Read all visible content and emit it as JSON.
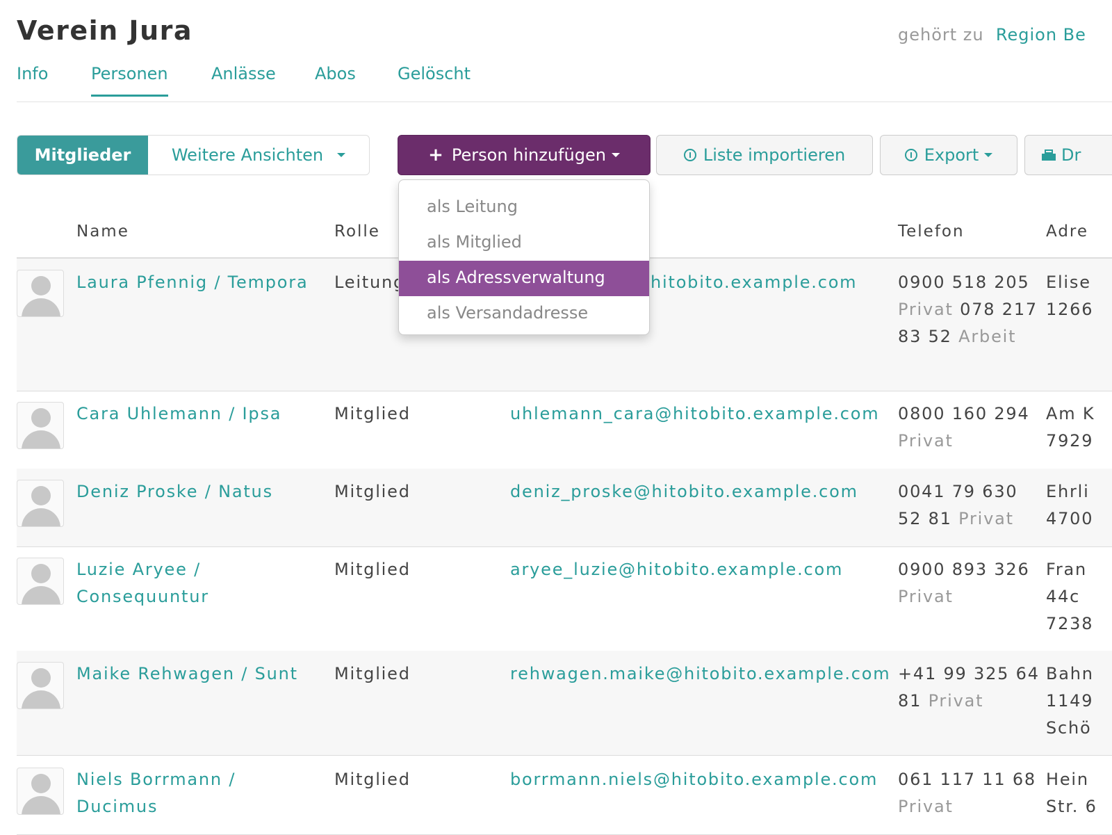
{
  "header": {
    "title": "Verein Jura",
    "belongs_to_label": "gehört zu",
    "belongs_to_link": "Region Be"
  },
  "tabs": [
    {
      "label": "Info"
    },
    {
      "label": "Personen"
    },
    {
      "label": "Anlässe"
    },
    {
      "label": "Abos"
    },
    {
      "label": "Gelöscht"
    }
  ],
  "toolbar": {
    "view_active": "Mitglieder",
    "view_more": "Weitere Ansichten",
    "add_person": "Person hinzufügen",
    "import_list": "Liste importieren",
    "export": "Export",
    "print": "Dr"
  },
  "add_person_menu": {
    "items": [
      "als Leitung",
      "als Mitglied",
      "als Adressverwaltung",
      "als Versandadresse"
    ],
    "highlighted": "als Adressverwaltung"
  },
  "table": {
    "columns": [
      "Name",
      "Rolle",
      "Telefon",
      "Adre"
    ],
    "rows": [
      {
        "name": "Laura Pfennig / Tempora",
        "role": "Leitung",
        "email": "hitobito.example.com",
        "phones": [
          {
            "number": "0900 518 205",
            "type": "Privat"
          },
          {
            "number": "078 217 83 52",
            "type": "Arbeit"
          }
        ],
        "address": [
          "Elise",
          "1266"
        ]
      },
      {
        "name": "Cara Uhlemann / Ipsa",
        "role": "Mitglied",
        "email": "uhlemann_cara@hitobito.example.com",
        "phones": [
          {
            "number": "0800 160 294",
            "type": "Privat"
          }
        ],
        "address": [
          "Am K",
          "7929"
        ]
      },
      {
        "name": "Deniz Proske / Natus",
        "role": "Mitglied",
        "email": "deniz_proske@hitobito.example.com",
        "phones": [
          {
            "number": "0041 79 630 52 81",
            "type": "Privat"
          }
        ],
        "address": [
          "Ehrli",
          "4700"
        ]
      },
      {
        "name": "Luzie Aryee / Consequuntur",
        "role": "Mitglied",
        "email": "aryee_luzie@hitobito.example.com",
        "phones": [
          {
            "number": "0900 893 326",
            "type": "Privat"
          }
        ],
        "address": [
          "Fran",
          "44c",
          "7238"
        ]
      },
      {
        "name": "Maike Rehwagen / Sunt",
        "role": "Mitglied",
        "email": "rehwagen.maike@hitobito.example.com",
        "phones": [
          {
            "number": "+41 99 325 64 81",
            "type": "Privat"
          }
        ],
        "address": [
          "Bahn",
          "1149",
          "Schö"
        ]
      },
      {
        "name": "Niels Borrmann / Ducimus",
        "role": "Mitglied",
        "email": "borrmann.niels@hitobito.example.com",
        "phones": [
          {
            "number": "061 117 11 68",
            "type": "Privat"
          }
        ],
        "address": [
          "Hein",
          "Str. 6"
        ]
      }
    ]
  },
  "colors": {
    "accent": "#2a9d9a",
    "primary_button": "#6b2d6b",
    "menu_highlight": "#8e4f98"
  }
}
